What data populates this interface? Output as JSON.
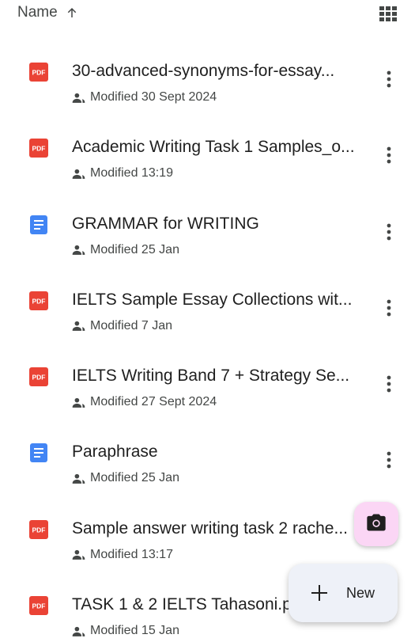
{
  "sort": {
    "label": "Name",
    "direction_icon": "arrow-upward-icon"
  },
  "view_toggle": {
    "icon": "grid-view-icon"
  },
  "files": [
    {
      "type": "pdf",
      "title": "30-advanced-synonyms-for-essay...",
      "modified": "Modified 30 Sept 2024"
    },
    {
      "type": "pdf",
      "title": "Academic Writing Task 1 Samples_o...",
      "modified": "Modified 13:19"
    },
    {
      "type": "doc",
      "title": "GRAMMAR for WRITING",
      "modified": "Modified 25 Jan"
    },
    {
      "type": "pdf",
      "title": "IELTS Sample Essay Collections wit...",
      "modified": "Modified 7 Jan"
    },
    {
      "type": "pdf",
      "title": "IELTS Writing Band 7 + Strategy Se...",
      "modified": "Modified 27 Sept 2024"
    },
    {
      "type": "doc",
      "title": "Paraphrase",
      "modified": "Modified 25 Jan"
    },
    {
      "type": "pdf",
      "title": "Sample answer writing task 2 rache...",
      "modified": "Modified 13:17"
    },
    {
      "type": "pdf",
      "title": "TASK 1 & 2 IELTS Tahasoni.p",
      "modified": "Modified 15 Jan"
    }
  ],
  "fab_camera": {
    "icon": "camera-icon"
  },
  "fab_new": {
    "label": "New",
    "icon": "plus-icon"
  },
  "colors": {
    "pdf_red": "#ea4335",
    "doc_blue": "#4285f4",
    "camera_fab_bg": "#fbd6f5",
    "new_fab_bg": "#eef1f8",
    "secondary_text": "#444746",
    "primary_text": "#1f1f1f"
  }
}
